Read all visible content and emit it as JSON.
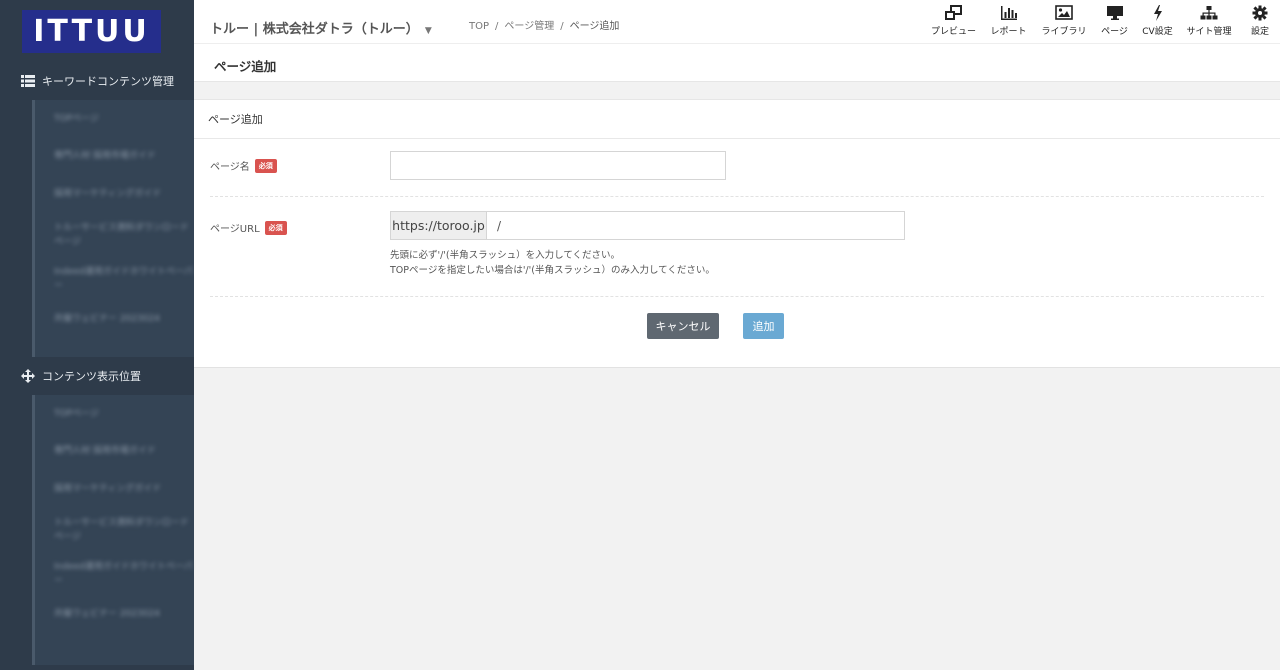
{
  "logo": "ITTUU",
  "sidebar": {
    "sections": [
      {
        "title": "キーワードコンテンツ管理",
        "icon": "list-icon",
        "items": [
          "TOPページ",
          "専門人材 採用市場ガイド",
          "採用マーケティングガイド",
          "トルーサービス資料ダウンロードページ",
          "Indeed運用ガイドホワイトペーパー",
          "共催ウェビナー 2023024"
        ]
      },
      {
        "title": "コンテンツ表示位置",
        "icon": "move-icon",
        "items": [
          "TOPページ",
          "専門人材 採用市場ガイド",
          "採用マーケティングガイド",
          "トルーサービス資料ダウンロードページ",
          "Indeed運用ガイドホワイトペーパー",
          "共催ウェビナー 2023024"
        ]
      }
    ]
  },
  "header": {
    "company": "トルー | 株式会社ダトラ（トルー）",
    "breadcrumb": [
      "TOP",
      "ページ管理",
      "ページ追加"
    ],
    "tools": [
      {
        "label": "プレビュー",
        "icon": "preview-icon"
      },
      {
        "label": "レポート",
        "icon": "bar-chart-icon"
      },
      {
        "label": "ライブラリ",
        "icon": "image-icon"
      },
      {
        "label": "ページ",
        "icon": "monitor-icon"
      },
      {
        "label": "CV設定",
        "icon": "bolt-icon"
      },
      {
        "label": "サイト管理",
        "icon": "sitemap-icon"
      },
      {
        "label": "設定",
        "icon": "gear-icon"
      }
    ]
  },
  "page_title": "ページ追加",
  "form": {
    "panel_title": "ページ追加",
    "name_label": "ページ名",
    "required": "必須",
    "name_value": "",
    "url_label": "ページURL",
    "url_prefix": "https://toroo.jp",
    "url_value": "/",
    "help_line1": "先頭に必ず'/'(半角スラッシュ）を入力してください。",
    "help_line2": "TOPページを指定したい場合は'/'(半角スラッシュ）のみ入力してください。",
    "cancel_label": "キャンセル",
    "add_label": "追加"
  }
}
